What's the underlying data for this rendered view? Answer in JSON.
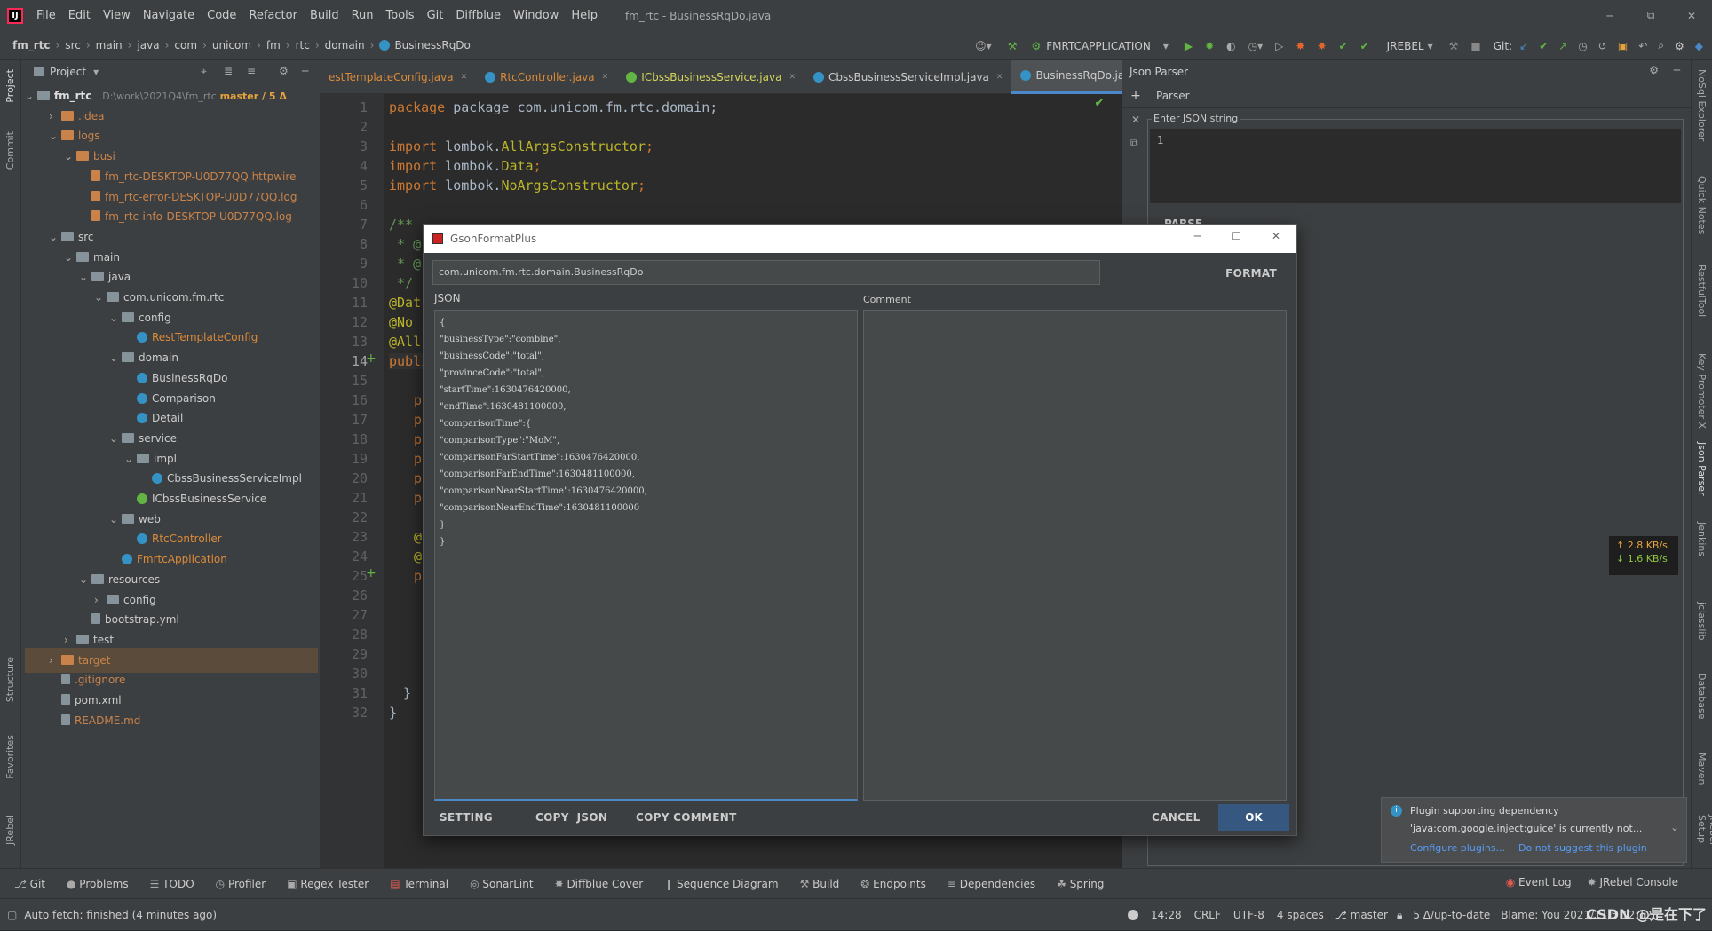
{
  "window": {
    "title": "fm_rtc - BusinessRqDo.java",
    "menu": [
      "File",
      "Edit",
      "View",
      "Navigate",
      "Code",
      "Refactor",
      "Build",
      "Run",
      "Tools",
      "Git",
      "Diffblue",
      "Window",
      "Help"
    ]
  },
  "breadcrumb": [
    "fm_rtc",
    "src",
    "main",
    "java",
    "com",
    "unicom",
    "fm",
    "rtc",
    "domain",
    "BusinessRqDo"
  ],
  "toolbar": {
    "run_config": "FMRTCAPPLICATION",
    "jrebel": "JREBEL",
    "git_label": "Git:"
  },
  "project": {
    "header": "Project",
    "root_name": "fm_rtc",
    "root_path": "D:\\work\\2021Q4\\fm_rtc",
    "root_branch": "master / 5 Δ",
    "tree": [
      {
        "label": ".idea",
        "type": "folder-orange"
      },
      {
        "label": "logs",
        "type": "folder-orange"
      },
      {
        "label": "busi",
        "type": "folder-orange"
      },
      {
        "label": "fm_rtc-DESKTOP-U0D77QQ.httpwire",
        "type": "file-log"
      },
      {
        "label": "fm_rtc-error-DESKTOP-U0D77QQ.log",
        "type": "file-log"
      },
      {
        "label": "fm_rtc-info-DESKTOP-U0D77QQ.log",
        "type": "file-log"
      },
      {
        "label": "src",
        "type": "folder"
      },
      {
        "label": "main",
        "type": "folder"
      },
      {
        "label": "java",
        "type": "folder"
      },
      {
        "label": "com.unicom.fm.rtc",
        "type": "folder"
      },
      {
        "label": "config",
        "type": "folder"
      },
      {
        "label": "RestTemplateConfig",
        "type": "class-orange"
      },
      {
        "label": "domain",
        "type": "folder"
      },
      {
        "label": "BusinessRqDo",
        "type": "class"
      },
      {
        "label": "Comparison",
        "type": "class"
      },
      {
        "label": "Detail",
        "type": "class"
      },
      {
        "label": "service",
        "type": "folder"
      },
      {
        "label": "impl",
        "type": "folder"
      },
      {
        "label": "CbssBusinessServiceImpl",
        "type": "class"
      },
      {
        "label": "ICbssBusinessService",
        "type": "interface"
      },
      {
        "label": "web",
        "type": "folder"
      },
      {
        "label": "RtcController",
        "type": "class-orange"
      },
      {
        "label": "FmrtcApplication",
        "type": "class-orange"
      },
      {
        "label": "resources",
        "type": "folder"
      },
      {
        "label": "config",
        "type": "folder"
      },
      {
        "label": "bootstrap.yml",
        "type": "file"
      },
      {
        "label": "test",
        "type": "folder"
      },
      {
        "label": "target",
        "type": "folder-orange"
      },
      {
        "label": ".gitignore",
        "type": "file"
      },
      {
        "label": "pom.xml",
        "type": "file"
      },
      {
        "label": "README.md",
        "type": "file"
      }
    ]
  },
  "editor": {
    "tabs": [
      "estTemplateConfig.java",
      "RtcController.java",
      "ICbssBusinessService.java",
      "CbssBusinessServiceImpl.java",
      "BusinessRqDo.java"
    ],
    "active_tab": 4,
    "line_numbers": [
      "1",
      "2",
      "3",
      "4",
      "5",
      "6",
      "7",
      "8",
      "9",
      "10",
      "11",
      "12",
      "13",
      "14",
      "15",
      "16",
      "17",
      "18",
      "19",
      "20",
      "21",
      "22",
      "23",
      "24",
      "25",
      "26",
      "27",
      "28",
      "29",
      "30",
      "31",
      "32"
    ],
    "code": {
      "l1": "package com.unicom.fm.rtc.domain;",
      "l3a": "import",
      "l3b": " lombok.",
      "l3c": "AllArgsConstructor",
      "l3d": ";",
      "l4a": "import",
      "l4b": " lombok.",
      "l4c": "Data",
      "l4d": ";",
      "l5a": "import",
      "l5b": " lombok.",
      "l5c": "NoArgsConstructor",
      "l5d": ";",
      "l7": "/**",
      "l8": " * @",
      "l9": " * @",
      "l10": " */",
      "l11": "@Dat",
      "l12": "@No",
      "l13": "@All",
      "l14": "public",
      "l16": "pr",
      "l17": "pr",
      "l18": "pr",
      "l19": "pr",
      "l20": "pr",
      "l21": "pr",
      "l23": "@",
      "l24": "@",
      "l25": "pr",
      "l31": "}",
      "l32": "}"
    }
  },
  "json_parser": {
    "title": "Json Parser",
    "tab": "Parser",
    "input_label": "Enter JSON string",
    "line_no": "1",
    "parse_button": "PARSE"
  },
  "dialog": {
    "title": "GsonFormatPlus",
    "class_field": "com.unicom.fm.rtc.domain.BusinessRqDo",
    "format_button": "FORMAT",
    "json_label": "JSON",
    "comment_label": "Comment",
    "json_lines": [
      "{",
      "\"businessType\":\"combine\",",
      "\"businessCode\":\"total\",",
      "\"provinceCode\":\"total\",",
      "\"startTime\":1630476420000,",
      "\"endTime\":1630481100000,",
      "\"comparisonTime\":{",
      "\"comparisonType\":\"MoM\",",
      "\"comparisonFarStartTime\":1630476420000,",
      "\"comparisonFarEndTime\":1630481100000,",
      "\"comparisonNearStartTime\":1630476420000,",
      "\"comparisonNearEndTime\":1630481100000",
      "}",
      "}"
    ],
    "setting_button": "SETTING",
    "copy_json_button": "COPY  JSON",
    "copy_comment_button": "COPY COMMENT",
    "cancel_button": "CANCEL",
    "ok_button": "OK"
  },
  "network": {
    "up": "↑ 2.8 KB/s",
    "down": "↓ 1.6 KB/s"
  },
  "notification": {
    "title": "Plugin supporting dependency",
    "body": "'java:com.google.inject:guice' is currently not...",
    "action1": "Configure plugins...",
    "action2": "Do not suggest this plugin"
  },
  "left_tools": [
    "Project",
    "Commit",
    "Structure",
    "Favorites",
    "JRebel"
  ],
  "right_tools": [
    "NoSql Explorer",
    "Quick Notes",
    "RestfulTool",
    "Key Promoter X",
    "Json Parser",
    "Jenkins",
    "jclasslib",
    "Database",
    "Maven",
    "JRebel Setup"
  ],
  "bottom_tools": [
    "Git",
    "Problems",
    "TODO",
    "Profiler",
    "Regex Tester",
    "Terminal",
    "SonarLint",
    "Diffblue Cover",
    "Sequence Diagram",
    "Build",
    "Endpoints",
    "Dependencies",
    "Spring"
  ],
  "bottom_right_tools": [
    "Event Log",
    "JRebel Console"
  ],
  "status": {
    "left": "Auto fetch: finished (4 minutes ago)",
    "position": "14:28",
    "line_sep": "CRLF",
    "encoding": "UTF-8",
    "indent": "4 spaces",
    "branch": "master",
    "vcs": "5 Δ/up-to-date",
    "blame": "Blame: You 2021/11/5 12:12",
    "watermark": "CSDN @是在下了"
  },
  "colors": {
    "accent": "#4a88c7",
    "ok_button": "#365880",
    "keyword": "#cc7832",
    "annotation": "#bbb529"
  }
}
